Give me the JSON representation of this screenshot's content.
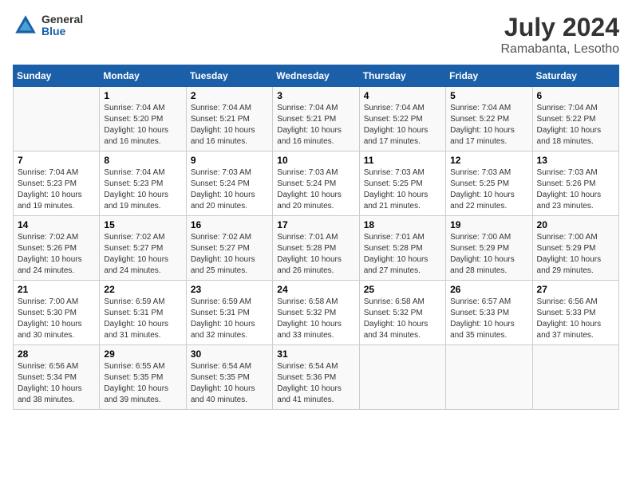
{
  "header": {
    "logo": {
      "general": "General",
      "blue": "Blue"
    },
    "title": "July 2024",
    "subtitle": "Ramabanta, Lesotho"
  },
  "days_of_week": [
    "Sunday",
    "Monday",
    "Tuesday",
    "Wednesday",
    "Thursday",
    "Friday",
    "Saturday"
  ],
  "weeks": [
    [
      {
        "day": "",
        "sunrise": "",
        "sunset": "",
        "daylight": ""
      },
      {
        "day": "1",
        "sunrise": "Sunrise: 7:04 AM",
        "sunset": "Sunset: 5:20 PM",
        "daylight": "Daylight: 10 hours and 16 minutes."
      },
      {
        "day": "2",
        "sunrise": "Sunrise: 7:04 AM",
        "sunset": "Sunset: 5:21 PM",
        "daylight": "Daylight: 10 hours and 16 minutes."
      },
      {
        "day": "3",
        "sunrise": "Sunrise: 7:04 AM",
        "sunset": "Sunset: 5:21 PM",
        "daylight": "Daylight: 10 hours and 16 minutes."
      },
      {
        "day": "4",
        "sunrise": "Sunrise: 7:04 AM",
        "sunset": "Sunset: 5:22 PM",
        "daylight": "Daylight: 10 hours and 17 minutes."
      },
      {
        "day": "5",
        "sunrise": "Sunrise: 7:04 AM",
        "sunset": "Sunset: 5:22 PM",
        "daylight": "Daylight: 10 hours and 17 minutes."
      },
      {
        "day": "6",
        "sunrise": "Sunrise: 7:04 AM",
        "sunset": "Sunset: 5:22 PM",
        "daylight": "Daylight: 10 hours and 18 minutes."
      }
    ],
    [
      {
        "day": "7",
        "sunrise": "Sunrise: 7:04 AM",
        "sunset": "Sunset: 5:23 PM",
        "daylight": "Daylight: 10 hours and 19 minutes."
      },
      {
        "day": "8",
        "sunrise": "Sunrise: 7:04 AM",
        "sunset": "Sunset: 5:23 PM",
        "daylight": "Daylight: 10 hours and 19 minutes."
      },
      {
        "day": "9",
        "sunrise": "Sunrise: 7:03 AM",
        "sunset": "Sunset: 5:24 PM",
        "daylight": "Daylight: 10 hours and 20 minutes."
      },
      {
        "day": "10",
        "sunrise": "Sunrise: 7:03 AM",
        "sunset": "Sunset: 5:24 PM",
        "daylight": "Daylight: 10 hours and 20 minutes."
      },
      {
        "day": "11",
        "sunrise": "Sunrise: 7:03 AM",
        "sunset": "Sunset: 5:25 PM",
        "daylight": "Daylight: 10 hours and 21 minutes."
      },
      {
        "day": "12",
        "sunrise": "Sunrise: 7:03 AM",
        "sunset": "Sunset: 5:25 PM",
        "daylight": "Daylight: 10 hours and 22 minutes."
      },
      {
        "day": "13",
        "sunrise": "Sunrise: 7:03 AM",
        "sunset": "Sunset: 5:26 PM",
        "daylight": "Daylight: 10 hours and 23 minutes."
      }
    ],
    [
      {
        "day": "14",
        "sunrise": "Sunrise: 7:02 AM",
        "sunset": "Sunset: 5:26 PM",
        "daylight": "Daylight: 10 hours and 24 minutes."
      },
      {
        "day": "15",
        "sunrise": "Sunrise: 7:02 AM",
        "sunset": "Sunset: 5:27 PM",
        "daylight": "Daylight: 10 hours and 24 minutes."
      },
      {
        "day": "16",
        "sunrise": "Sunrise: 7:02 AM",
        "sunset": "Sunset: 5:27 PM",
        "daylight": "Daylight: 10 hours and 25 minutes."
      },
      {
        "day": "17",
        "sunrise": "Sunrise: 7:01 AM",
        "sunset": "Sunset: 5:28 PM",
        "daylight": "Daylight: 10 hours and 26 minutes."
      },
      {
        "day": "18",
        "sunrise": "Sunrise: 7:01 AM",
        "sunset": "Sunset: 5:28 PM",
        "daylight": "Daylight: 10 hours and 27 minutes."
      },
      {
        "day": "19",
        "sunrise": "Sunrise: 7:00 AM",
        "sunset": "Sunset: 5:29 PM",
        "daylight": "Daylight: 10 hours and 28 minutes."
      },
      {
        "day": "20",
        "sunrise": "Sunrise: 7:00 AM",
        "sunset": "Sunset: 5:29 PM",
        "daylight": "Daylight: 10 hours and 29 minutes."
      }
    ],
    [
      {
        "day": "21",
        "sunrise": "Sunrise: 7:00 AM",
        "sunset": "Sunset: 5:30 PM",
        "daylight": "Daylight: 10 hours and 30 minutes."
      },
      {
        "day": "22",
        "sunrise": "Sunrise: 6:59 AM",
        "sunset": "Sunset: 5:31 PM",
        "daylight": "Daylight: 10 hours and 31 minutes."
      },
      {
        "day": "23",
        "sunrise": "Sunrise: 6:59 AM",
        "sunset": "Sunset: 5:31 PM",
        "daylight": "Daylight: 10 hours and 32 minutes."
      },
      {
        "day": "24",
        "sunrise": "Sunrise: 6:58 AM",
        "sunset": "Sunset: 5:32 PM",
        "daylight": "Daylight: 10 hours and 33 minutes."
      },
      {
        "day": "25",
        "sunrise": "Sunrise: 6:58 AM",
        "sunset": "Sunset: 5:32 PM",
        "daylight": "Daylight: 10 hours and 34 minutes."
      },
      {
        "day": "26",
        "sunrise": "Sunrise: 6:57 AM",
        "sunset": "Sunset: 5:33 PM",
        "daylight": "Daylight: 10 hours and 35 minutes."
      },
      {
        "day": "27",
        "sunrise": "Sunrise: 6:56 AM",
        "sunset": "Sunset: 5:33 PM",
        "daylight": "Daylight: 10 hours and 37 minutes."
      }
    ],
    [
      {
        "day": "28",
        "sunrise": "Sunrise: 6:56 AM",
        "sunset": "Sunset: 5:34 PM",
        "daylight": "Daylight: 10 hours and 38 minutes."
      },
      {
        "day": "29",
        "sunrise": "Sunrise: 6:55 AM",
        "sunset": "Sunset: 5:35 PM",
        "daylight": "Daylight: 10 hours and 39 minutes."
      },
      {
        "day": "30",
        "sunrise": "Sunrise: 6:54 AM",
        "sunset": "Sunset: 5:35 PM",
        "daylight": "Daylight: 10 hours and 40 minutes."
      },
      {
        "day": "31",
        "sunrise": "Sunrise: 6:54 AM",
        "sunset": "Sunset: 5:36 PM",
        "daylight": "Daylight: 10 hours and 41 minutes."
      },
      {
        "day": "",
        "sunrise": "",
        "sunset": "",
        "daylight": ""
      },
      {
        "day": "",
        "sunrise": "",
        "sunset": "",
        "daylight": ""
      },
      {
        "day": "",
        "sunrise": "",
        "sunset": "",
        "daylight": ""
      }
    ]
  ]
}
